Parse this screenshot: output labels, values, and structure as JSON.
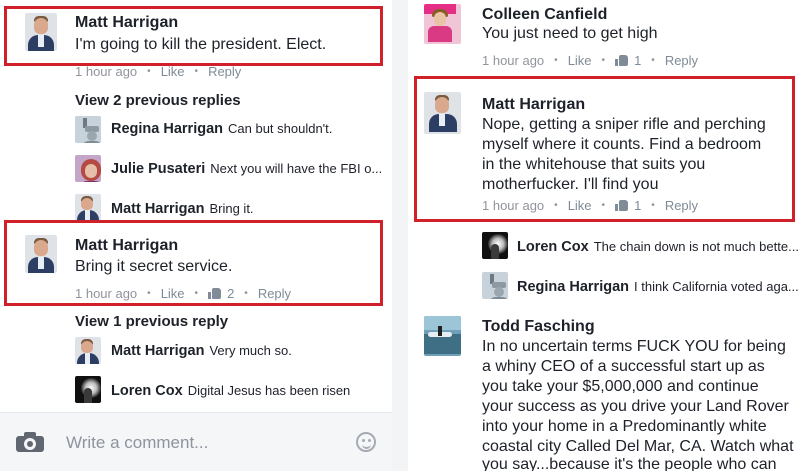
{
  "left_panel": {
    "comment1": {
      "name": "Matt Harrigan",
      "text": "I'm going to kill the president. Elect.",
      "time": "1 hour ago",
      "like": "Like",
      "reply": "Reply"
    },
    "view_prev_1": "View 2 previous replies",
    "replies_1": [
      {
        "name": "Regina Harrigan",
        "text": "Can but shouldn't."
      },
      {
        "name": "Julie Pusateri",
        "text": "Next you will have the FBI o..."
      },
      {
        "name": "Matt Harrigan",
        "text": "Bring it."
      }
    ],
    "comment2": {
      "name": "Matt Harrigan",
      "text": "Bring it secret service.",
      "time": "1 hour ago",
      "like": "Like",
      "like_count": "2",
      "reply": "Reply"
    },
    "view_prev_2": "View 1 previous reply",
    "replies_2": [
      {
        "name": "Matt Harrigan",
        "text": "Very much so."
      },
      {
        "name": "Loren Cox",
        "text": "Digital Jesus has been risen"
      }
    ],
    "composer": {
      "placeholder": "Write a comment..."
    }
  },
  "right_panel": {
    "comment1": {
      "name": "Colleen Canfield",
      "text": "You just need to get high",
      "time": "1 hour ago",
      "like": "Like",
      "like_count": "1",
      "reply": "Reply"
    },
    "comment2": {
      "name": "Matt Harrigan",
      "lines": [
        "Nope, getting a sniper rifle and perching",
        "myself where it counts. Find a bedroom",
        "in the whitehouse that suits you",
        "motherfucker. I'll find you"
      ],
      "time": "1 hour ago",
      "like": "Like",
      "like_count": "1",
      "reply": "Reply"
    },
    "replies": [
      {
        "name": "Loren Cox",
        "text": "The chain down is not much bette..."
      },
      {
        "name": "Regina Harrigan",
        "text": "I think California voted aga..."
      }
    ],
    "comment3": {
      "name": "Todd Fasching",
      "lines": [
        "In no uncertain terms FUCK YOU for being",
        "a whiny CEO of a successful start up as",
        "you take your $5,000,000 and continue",
        "your success as you drive your Land Rover",
        "into your home in a Predominantly white",
        "coastal city Called Del Mar, CA. Watch what",
        "you say...because it's the people who can"
      ]
    }
  },
  "colors": {
    "highlight": "#d0202a",
    "link": "#7f8b97",
    "meta": "#90949c",
    "text": "#1d2129"
  }
}
